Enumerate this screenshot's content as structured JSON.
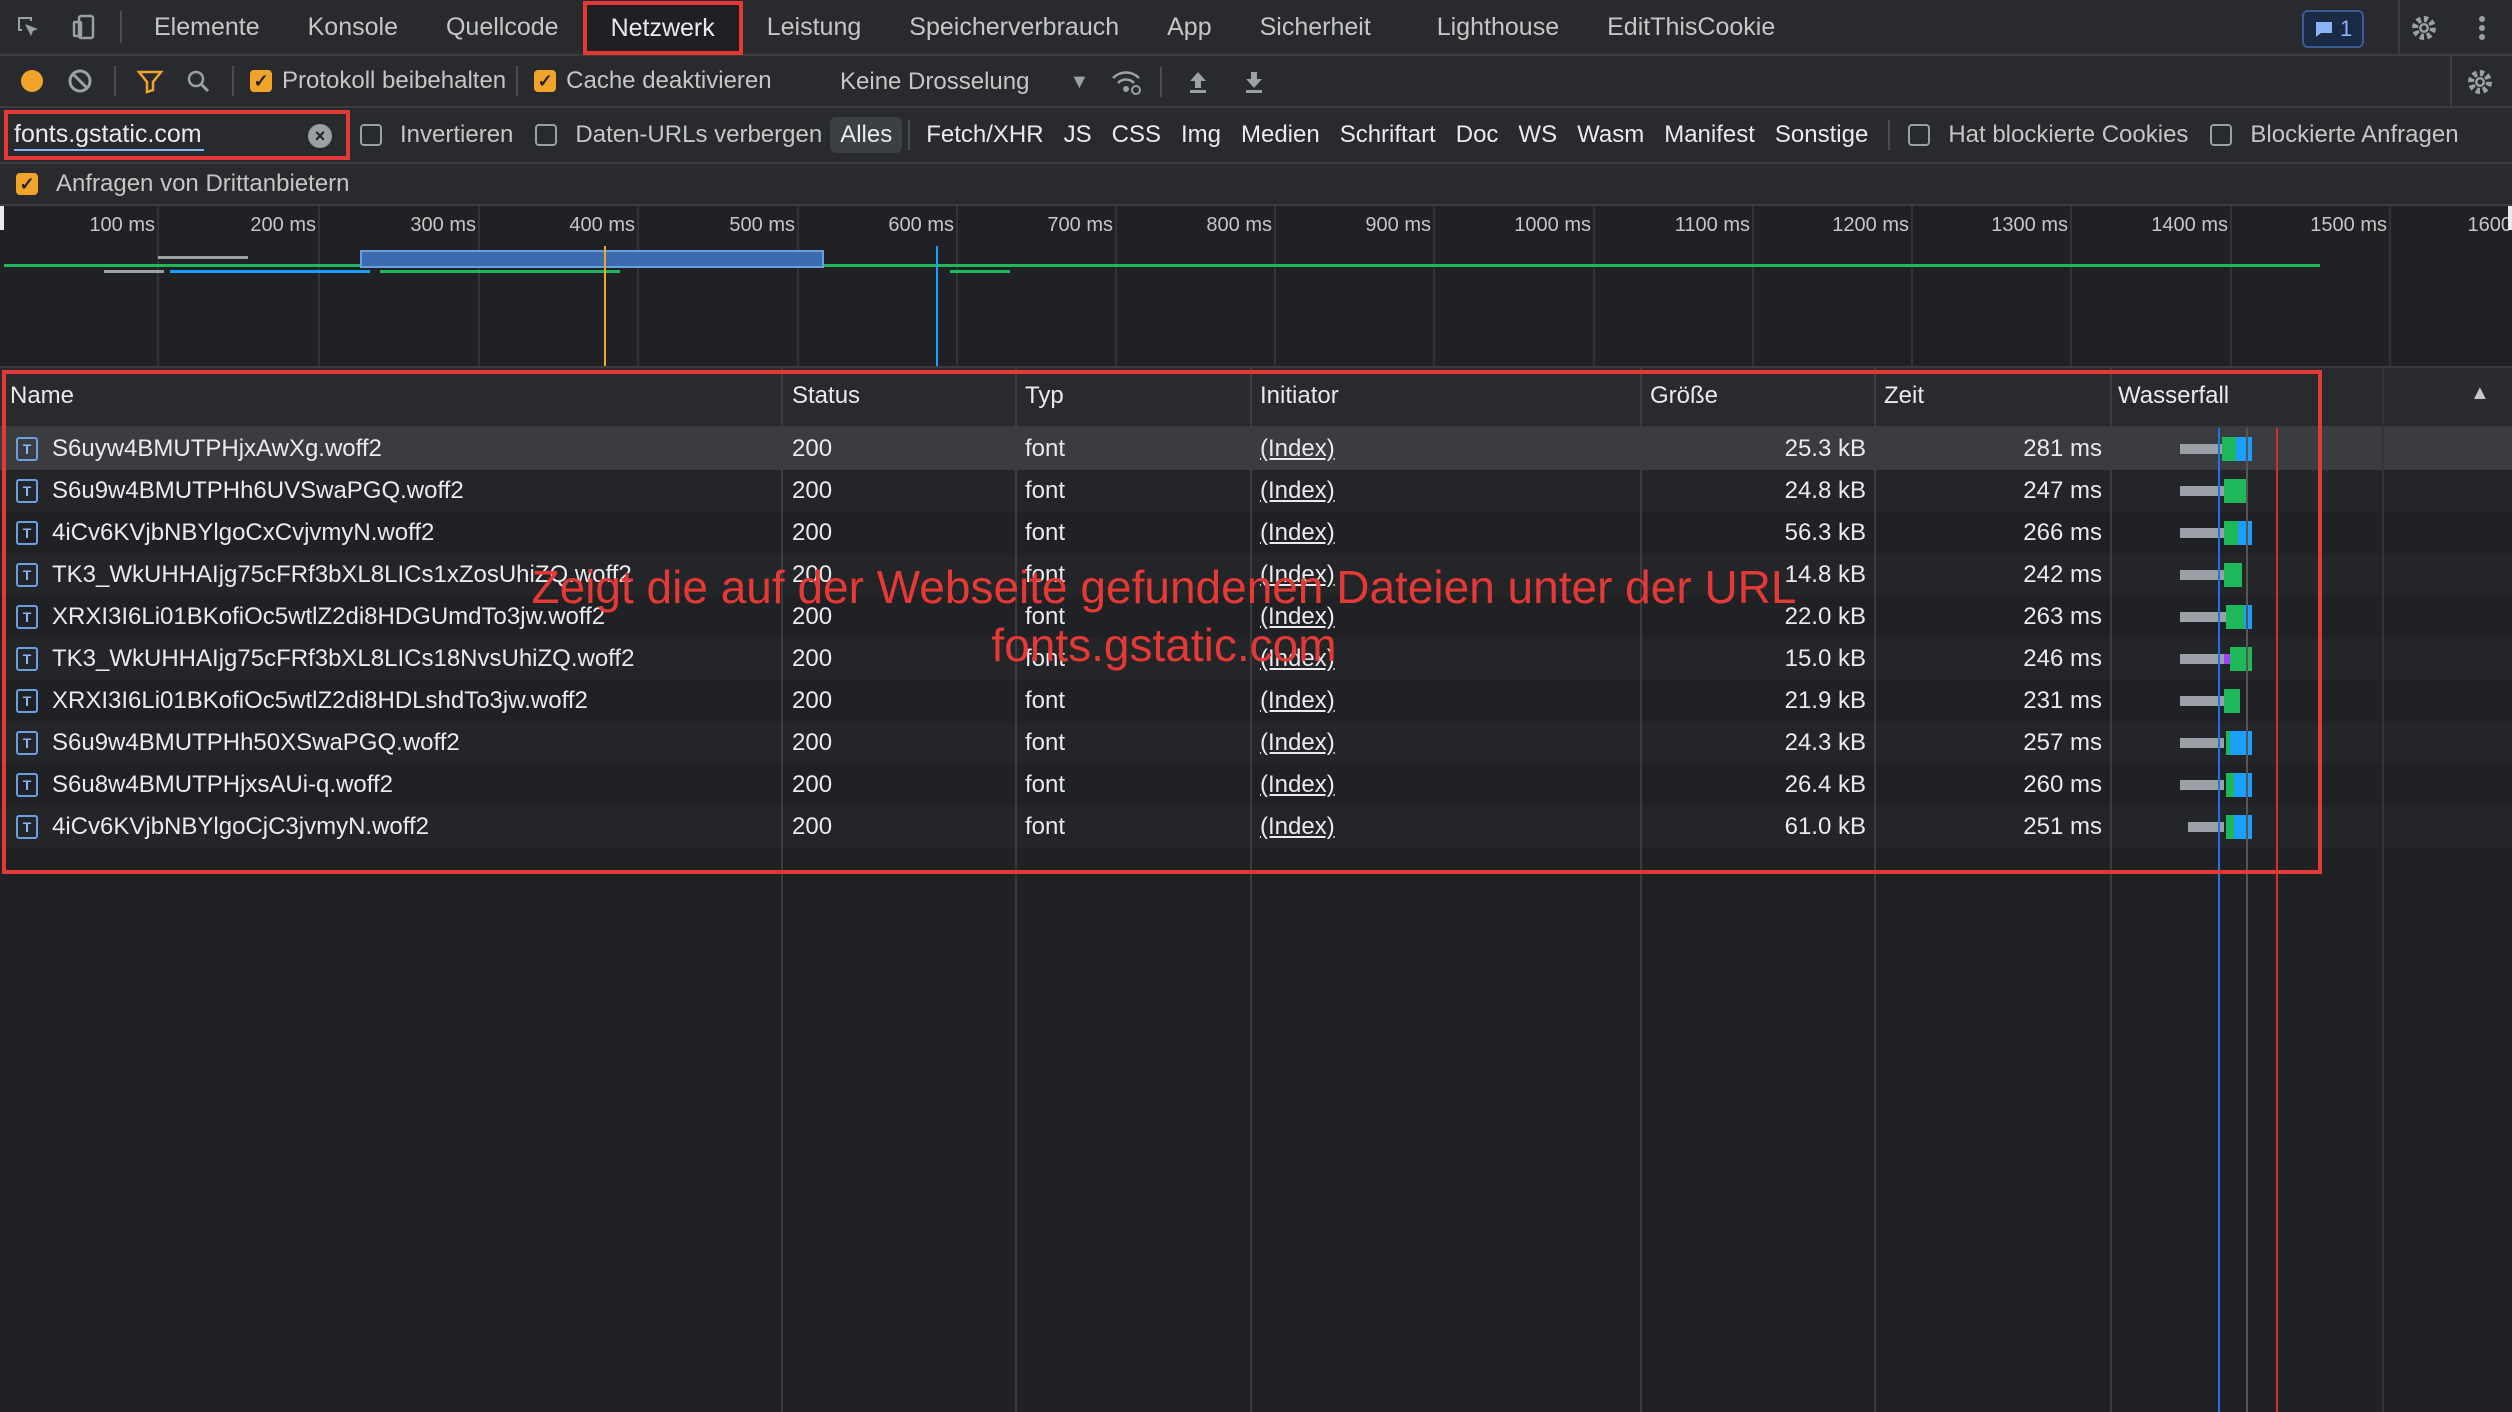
{
  "tabs": {
    "items": [
      "Elemente",
      "Konsole",
      "Quellcode",
      "Netzwerk",
      "Leistung",
      "Speicherverbrauch",
      "App",
      "Sicherheit",
      "Lighthouse",
      "EditThisCookie"
    ],
    "active": "Netzwerk",
    "messages_count": "1"
  },
  "toolbar": {
    "preserve_log": "Protokoll beibehalten",
    "disable_cache": "Cache deaktivieren",
    "throttling": "Keine Drosselung"
  },
  "filter": {
    "value": "fonts.gstatic.com",
    "invert": "Invertieren",
    "hide_data_urls": "Daten-URLs verbergen",
    "types": [
      "Alles",
      "Fetch/XHR",
      "JS",
      "CSS",
      "Img",
      "Medien",
      "Schriftart",
      "Doc",
      "WS",
      "Wasm",
      "Manifest",
      "Sonstige"
    ],
    "selected_type": "Alles",
    "blocked_cookies": "Hat blockierte Cookies",
    "blocked_requests": "Blockierte Anfragen",
    "third_party": "Anfragen von Drittanbietern"
  },
  "overview": {
    "ticks": [
      "100 ms",
      "200 ms",
      "300 ms",
      "400 ms",
      "500 ms",
      "600 ms",
      "700 ms",
      "800 ms",
      "900 ms",
      "1000 ms",
      "1100 ms",
      "1200 ms",
      "1300 ms",
      "1400 ms",
      "1500 ms",
      "1600"
    ]
  },
  "table": {
    "columns": [
      "Name",
      "Status",
      "Typ",
      "Initiator",
      "Größe",
      "Zeit",
      "Wasserfall"
    ],
    "rows": [
      {
        "name": "S6uyw4BMUTPHjxAwXg.woff2",
        "status": "200",
        "type": "font",
        "initiator": "(Index)",
        "size": "25.3 kB",
        "time": "281 ms"
      },
      {
        "name": "S6u9w4BMUTPHh6UVSwaPGQ.woff2",
        "status": "200",
        "type": "font",
        "initiator": "(Index)",
        "size": "24.8 kB",
        "time": "247 ms"
      },
      {
        "name": "4iCv6KVjbNBYlgoCxCvjvmyN.woff2",
        "status": "200",
        "type": "font",
        "initiator": "(Index)",
        "size": "56.3 kB",
        "time": "266 ms"
      },
      {
        "name": "TK3_WkUHHAIjg75cFRf3bXL8LICs1xZosUhiZQ.woff2",
        "status": "200",
        "type": "font",
        "initiator": "(Index)",
        "size": "14.8 kB",
        "time": "242 ms"
      },
      {
        "name": "XRXI3I6Li01BKofiOc5wtlZ2di8HDGUmdTo3jw.woff2",
        "status": "200",
        "type": "font",
        "initiator": "(Index)",
        "size": "22.0 kB",
        "time": "263 ms"
      },
      {
        "name": "TK3_WkUHHAIjg75cFRf3bXL8LICs18NvsUhiZQ.woff2",
        "status": "200",
        "type": "font",
        "initiator": "(Index)",
        "size": "15.0 kB",
        "time": "246 ms"
      },
      {
        "name": "XRXI3I6Li01BKofiOc5wtlZ2di8HDLshdTo3jw.woff2",
        "status": "200",
        "type": "font",
        "initiator": "(Index)",
        "size": "21.9 kB",
        "time": "231 ms"
      },
      {
        "name": "S6u9w4BMUTPHh50XSwaPGQ.woff2",
        "status": "200",
        "type": "font",
        "initiator": "(Index)",
        "size": "24.3 kB",
        "time": "257 ms"
      },
      {
        "name": "S6u8w4BMUTPHjxsAUi-q.woff2",
        "status": "200",
        "type": "font",
        "initiator": "(Index)",
        "size": "26.4 kB",
        "time": "260 ms"
      },
      {
        "name": "4iCv6KVjbNBYlgoCjC3jvmyN.woff2",
        "status": "200",
        "type": "font",
        "initiator": "(Index)",
        "size": "61.0 kB",
        "time": "251 ms"
      }
    ]
  },
  "annotation": {
    "line1": "Zeigt die auf der Webseite gefundenen Dateien unter der URL",
    "line2": "fonts.gstatic.com"
  },
  "colors": {
    "annotation_red": "#e53935",
    "checkbox_orange": "#f0a52a",
    "waterfall_blue": "#1a9fff",
    "waterfall_green": "#1eb85a"
  }
}
